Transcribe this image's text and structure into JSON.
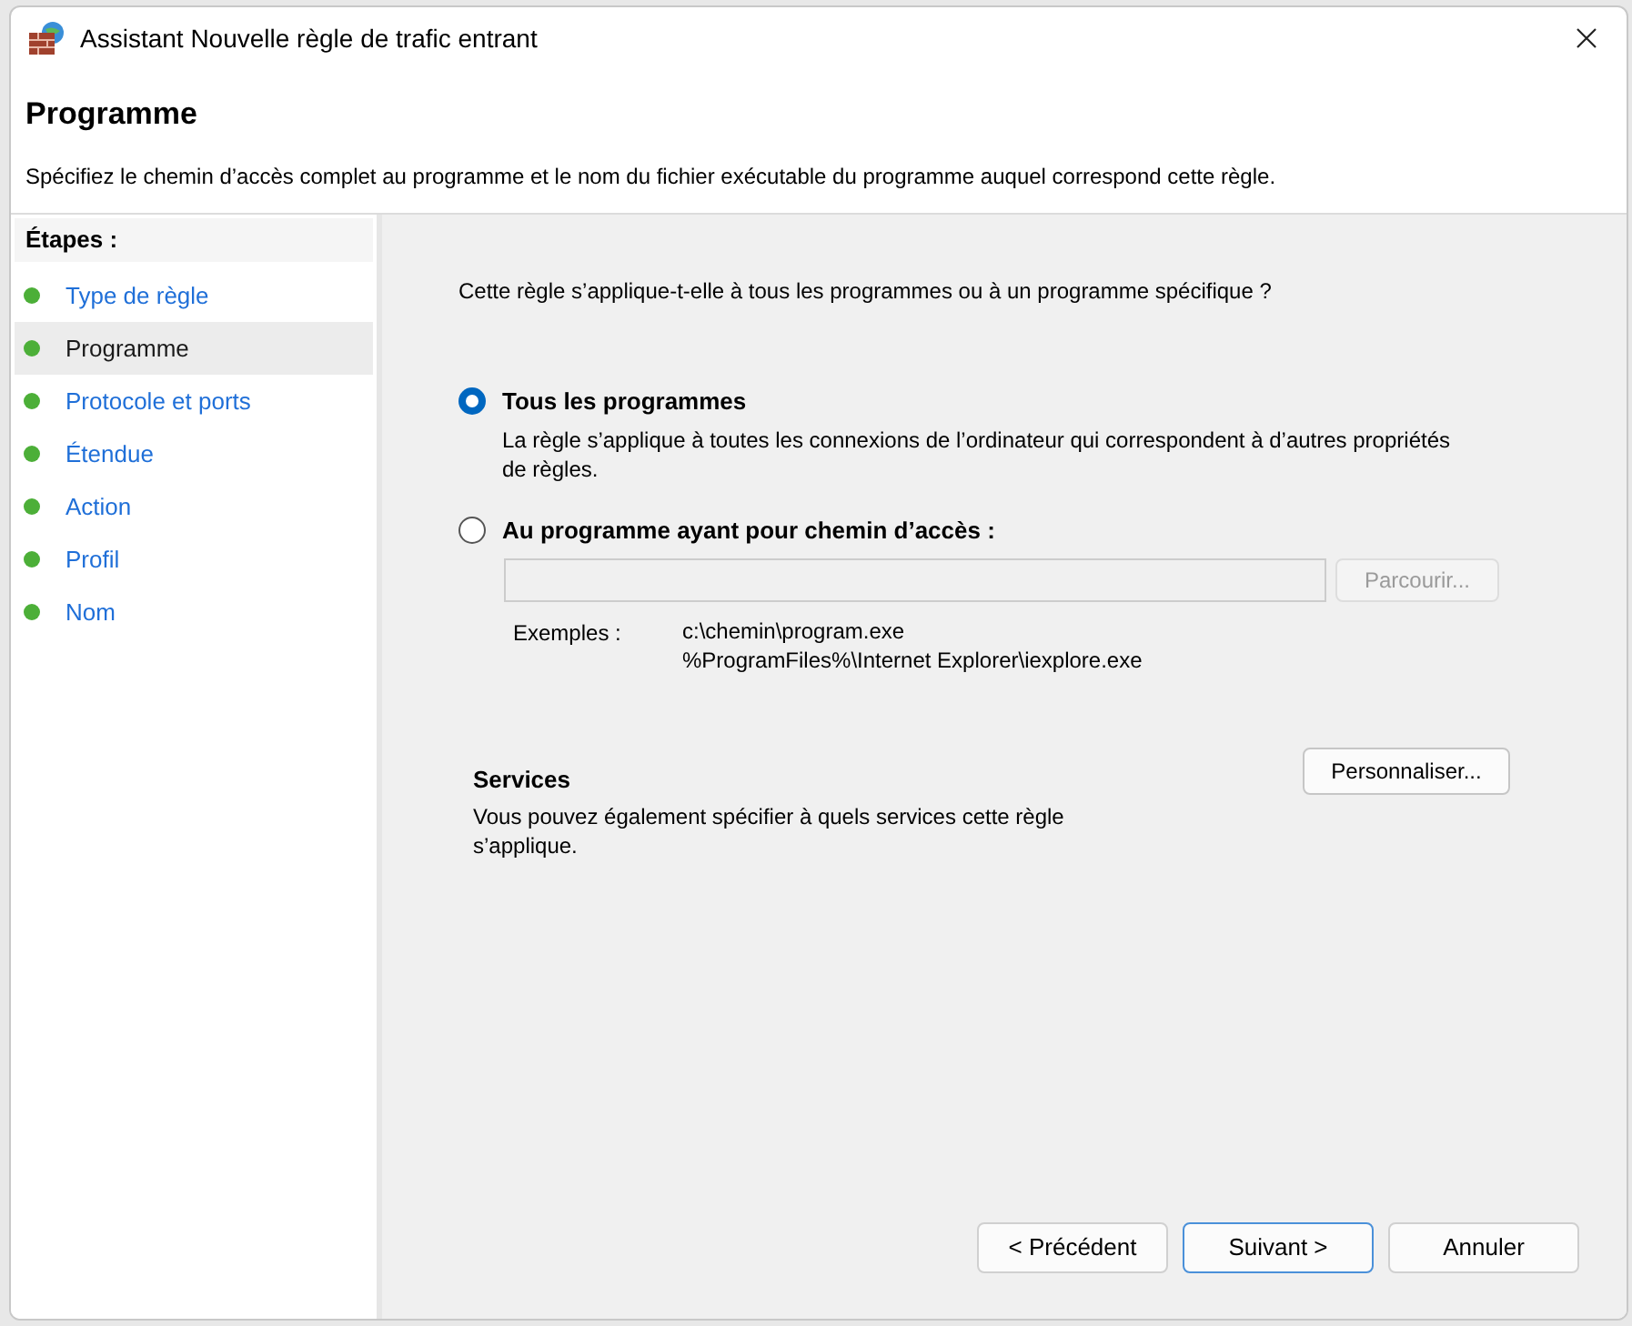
{
  "window": {
    "title": "Assistant Nouvelle règle de trafic entrant"
  },
  "header": {
    "title": "Programme",
    "description": "Spécifiez le chemin d’accès complet au programme et le nom du fichier exécutable du programme auquel correspond cette règle."
  },
  "steps": {
    "title": "Étapes :",
    "items": [
      {
        "label": "Type de règle",
        "selected": false
      },
      {
        "label": "Programme",
        "selected": true
      },
      {
        "label": "Protocole et ports",
        "selected": false
      },
      {
        "label": "Étendue",
        "selected": false
      },
      {
        "label": "Action",
        "selected": false
      },
      {
        "label": "Profil",
        "selected": false
      },
      {
        "label": "Nom",
        "selected": false
      }
    ]
  },
  "question": "Cette règle s’applique-t-elle à tous les programmes ou à un programme spécifique ?",
  "options": [
    {
      "label": "Tous les programmes",
      "selected": true,
      "description": "La règle s’applique à toutes les connexions de l’ordinateur qui correspondent à d’autres propriétés de règles."
    },
    {
      "label": "Au programme ayant pour chemin d’accès :",
      "selected": false
    }
  ],
  "path_field": {
    "disabled": true,
    "browse_button": "Parcourir..."
  },
  "examples": {
    "label": "Exemples :",
    "lines": [
      "c:\\chemin\\program.exe",
      "%ProgramFiles%\\Internet Explorer\\iexplore.exe"
    ]
  },
  "services": {
    "title": "Services",
    "description": "Vous pouvez également spécifier à quels services cette règle s’applique.",
    "button": "Personnaliser..."
  },
  "buttons": [
    {
      "label": "< Précédent",
      "selected": false
    },
    {
      "label": "Suivant >",
      "selected": true
    },
    {
      "label": "Annuler",
      "selected": false
    }
  ]
}
